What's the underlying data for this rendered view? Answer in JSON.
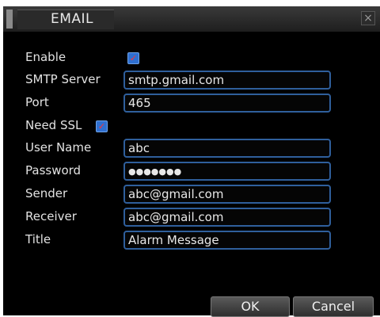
{
  "dialog": {
    "title": "EMAIL",
    "close_symbol": "×"
  },
  "fields": {
    "enable": {
      "label": "Enable",
      "checked": true
    },
    "smtp_server": {
      "label": "SMTP Server",
      "value": "smtp.gmail.com"
    },
    "port": {
      "label": "Port",
      "value": "465"
    },
    "need_ssl": {
      "label": "Need SSL",
      "checked": true
    },
    "user_name": {
      "label": "User Name",
      "value": "abc"
    },
    "password": {
      "label": "Password",
      "value": "●●●●●●●"
    },
    "sender": {
      "label": "Sender",
      "value": "abc@gmail.com"
    },
    "receiver": {
      "label": "Receiver",
      "value": "abc@gmail.com"
    },
    "title": {
      "label": "Title",
      "value": "Alarm Message"
    }
  },
  "buttons": {
    "ok": "OK",
    "cancel": "Cancel"
  },
  "icons": {
    "checkbox_mark": "✓"
  },
  "colors": {
    "background": "#000000",
    "field_border": "#2f5f9c",
    "checkbox": "#2f6fd0"
  }
}
